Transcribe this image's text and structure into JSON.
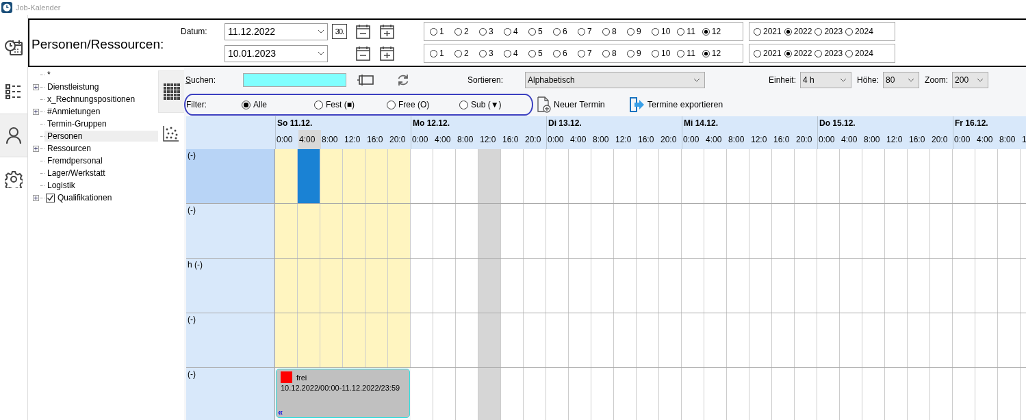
{
  "window": {
    "title": "Job-Kalender"
  },
  "nav_tabs": [
    {
      "kind": "schedule",
      "selected": false
    },
    {
      "kind": "list",
      "selected": false
    },
    {
      "kind": "person",
      "selected": true
    },
    {
      "kind": "settings",
      "selected": false
    }
  ],
  "header": {
    "title": "Personen/Ressourcen:",
    "date_label": "Datum:",
    "date_rows": [
      {
        "date": "11.12.2022",
        "today_button": "30.",
        "months": [
          {
            "label": "1",
            "selected": false
          },
          {
            "label": "2",
            "selected": false
          },
          {
            "label": "3",
            "selected": false
          },
          {
            "label": "4",
            "selected": false
          },
          {
            "label": "5",
            "selected": false
          },
          {
            "label": "6",
            "selected": false
          },
          {
            "label": "7",
            "selected": false
          },
          {
            "label": "8",
            "selected": false
          },
          {
            "label": "9",
            "selected": false
          },
          {
            "label": "10",
            "selected": false
          },
          {
            "label": "11",
            "selected": false
          },
          {
            "label": "12",
            "selected": true
          }
        ],
        "years": [
          {
            "label": "2021",
            "selected": false
          },
          {
            "label": "2022",
            "selected": true
          },
          {
            "label": "2023",
            "selected": false
          },
          {
            "label": "2024",
            "selected": false
          }
        ]
      },
      {
        "date": "10.01.2023",
        "months": [
          {
            "label": "1",
            "selected": false
          },
          {
            "label": "2",
            "selected": false
          },
          {
            "label": "3",
            "selected": false
          },
          {
            "label": "4",
            "selected": false
          },
          {
            "label": "5",
            "selected": false
          },
          {
            "label": "6",
            "selected": false
          },
          {
            "label": "7",
            "selected": false
          },
          {
            "label": "8",
            "selected": false
          },
          {
            "label": "9",
            "selected": false
          },
          {
            "label": "10",
            "selected": false
          },
          {
            "label": "11",
            "selected": false
          },
          {
            "label": "12",
            "selected": true
          }
        ],
        "years": [
          {
            "label": "2021",
            "selected": false
          },
          {
            "label": "2022",
            "selected": true
          },
          {
            "label": "2023",
            "selected": false
          },
          {
            "label": "2024",
            "selected": false
          }
        ]
      }
    ]
  },
  "tree": {
    "items": [
      {
        "label": "*",
        "kind": "leaf",
        "selected": false
      },
      {
        "label": "Dienstleistung",
        "kind": "group",
        "selected": false
      },
      {
        "label": "x_Rechnungspositionen",
        "kind": "leaf",
        "selected": false
      },
      {
        "label": "#Anmietungen",
        "kind": "group",
        "selected": false
      },
      {
        "label": "Termin-Gruppen",
        "kind": "leaf",
        "selected": false
      },
      {
        "label": "Personen",
        "kind": "leaf",
        "selected": true
      },
      {
        "label": "Ressourcen",
        "kind": "group",
        "selected": false
      },
      {
        "label": "Fremdpersonal",
        "kind": "leaf",
        "selected": false
      },
      {
        "label": "Lager/Werkstatt",
        "kind": "leaf",
        "selected": false
      },
      {
        "label": "Logistik",
        "kind": "leaf",
        "selected": false
      },
      {
        "label": "Qualifikationen",
        "kind": "check-group",
        "selected": false,
        "checked": true
      }
    ]
  },
  "view_tabs": [
    {
      "kind": "grid",
      "selected": true
    },
    {
      "kind": "dots",
      "selected": false
    }
  ],
  "toolbar": {
    "search_label": "Suchen:",
    "sort_label": "Sortieren:",
    "sort_value": "Alphabetisch",
    "unit_label": "Einheit:",
    "unit_value": "4 h",
    "height_label": "Höhe:",
    "height_value": "80",
    "zoom_label": "Zoom:",
    "zoom_value": "200"
  },
  "filter": {
    "label": "Filter:",
    "options": [
      {
        "label": "Alle",
        "selected": true
      },
      {
        "label": "Fest (■)",
        "selected": false
      },
      {
        "label": "Free (O)",
        "selected": false
      },
      {
        "label": "Sub (▼)",
        "selected": false
      }
    ]
  },
  "actions": [
    {
      "kind": "new",
      "label": "Neuer Termin"
    },
    {
      "kind": "export",
      "label": "Termine exportieren"
    }
  ],
  "calendar": {
    "days": [
      {
        "label": "So 11.12.",
        "weekend": true,
        "hours": [
          {
            "label": "0:00",
            "selected": false,
            "current": false
          },
          {
            "label": "4:00",
            "selected": true,
            "current": false
          },
          {
            "label": "8:00",
            "selected": false,
            "current": false
          },
          {
            "label": "12:0",
            "selected": false,
            "current": false
          },
          {
            "label": "16:0",
            "selected": false,
            "current": false
          },
          {
            "label": "20:0",
            "selected": false,
            "current": false
          }
        ]
      },
      {
        "label": "Mo 12.12.",
        "weekend": false,
        "hours": [
          {
            "label": "0:00",
            "selected": false,
            "current": false
          },
          {
            "label": "4:00",
            "selected": false,
            "current": false
          },
          {
            "label": "8:00",
            "selected": false,
            "current": false
          },
          {
            "label": "12:0",
            "selected": false,
            "current": true
          },
          {
            "label": "16:0",
            "selected": false,
            "current": false
          },
          {
            "label": "20:0",
            "selected": false,
            "current": false
          }
        ]
      },
      {
        "label": "Di 13.12.",
        "weekend": false,
        "hours": [
          {
            "label": "0:00",
            "selected": false,
            "current": false
          },
          {
            "label": "4:00",
            "selected": false,
            "current": false
          },
          {
            "label": "8:00",
            "selected": false,
            "current": false
          },
          {
            "label": "12:0",
            "selected": false,
            "current": false
          },
          {
            "label": "16:0",
            "selected": false,
            "current": false
          },
          {
            "label": "20:0",
            "selected": false,
            "current": false
          }
        ]
      },
      {
        "label": "Mi 14.12.",
        "weekend": false,
        "hours": [
          {
            "label": "0:00",
            "selected": false,
            "current": false
          },
          {
            "label": "4:00",
            "selected": false,
            "current": false
          },
          {
            "label": "8:00",
            "selected": false,
            "current": false
          },
          {
            "label": "12:0",
            "selected": false,
            "current": false
          },
          {
            "label": "16:0",
            "selected": false,
            "current": false
          },
          {
            "label": "20:0",
            "selected": false,
            "current": false
          }
        ]
      },
      {
        "label": "Do 15.12.",
        "weekend": false,
        "hours": [
          {
            "label": "0:00",
            "selected": false,
            "current": false
          },
          {
            "label": "4:00",
            "selected": false,
            "current": false
          },
          {
            "label": "8:00",
            "selected": false,
            "current": false
          },
          {
            "label": "12:0",
            "selected": false,
            "current": false
          },
          {
            "label": "16:0",
            "selected": false,
            "current": false
          },
          {
            "label": "20:0",
            "selected": false,
            "current": false
          }
        ]
      },
      {
        "label": "Fr 16.12.",
        "weekend": false,
        "hours": [
          {
            "label": "0:00",
            "selected": false,
            "current": false
          },
          {
            "label": "4:00",
            "selected": false,
            "current": false
          },
          {
            "label": "8:00",
            "selected": false,
            "current": false
          },
          {
            "label": "1",
            "selected": false,
            "current": false
          }
        ]
      }
    ],
    "rows": [
      {
        "label": "(-)",
        "selected": true,
        "days": [
          {
            "kind": "slots",
            "busy": [
              false,
              true,
              false,
              false,
              false,
              false
            ]
          },
          {
            "kind": "slots"
          },
          {
            "kind": "slots"
          },
          {
            "kind": "slots"
          },
          {
            "kind": "slots"
          },
          {
            "kind": "slots"
          }
        ]
      },
      {
        "label": "(-)",
        "selected": false,
        "days": [
          {
            "kind": "slots"
          },
          {
            "kind": "slots"
          },
          {
            "kind": "slots"
          },
          {
            "kind": "slots"
          },
          {
            "kind": "slots"
          },
          {
            "kind": "slots"
          }
        ]
      },
      {
        "label": "h (-)",
        "selected": false,
        "days": [
          {
            "kind": "slots"
          },
          {
            "kind": "slots"
          },
          {
            "kind": "slots"
          },
          {
            "kind": "slots"
          },
          {
            "kind": "slots"
          },
          {
            "kind": "slots"
          }
        ]
      },
      {
        "label": "(-)",
        "selected": false,
        "days": [
          {
            "kind": "slots"
          },
          {
            "kind": "slots"
          },
          {
            "kind": "slots"
          },
          {
            "kind": "slots"
          },
          {
            "kind": "slots"
          },
          {
            "kind": "slots"
          }
        ]
      },
      {
        "label": "(-)",
        "selected": false,
        "days": [
          {
            "kind": "appointment",
            "title": "frei",
            "range": "10.12.2022/00:00-11.12.2022/23:59",
            "color": "#ff0000",
            "more": "«"
          },
          {
            "kind": "slots"
          },
          {
            "kind": "slots"
          },
          {
            "kind": "slots"
          },
          {
            "kind": "slots"
          },
          {
            "kind": "slots"
          }
        ]
      }
    ]
  }
}
